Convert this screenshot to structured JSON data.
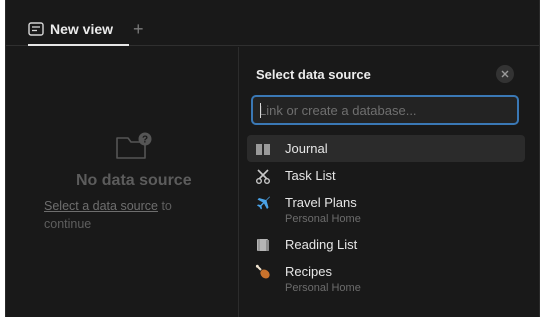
{
  "tab": {
    "label": "New view",
    "add_symbol": "+"
  },
  "empty_state": {
    "title": "No data source",
    "link_text": "Select a data source",
    "rest_text": " to continue"
  },
  "panel": {
    "title": "Select data source",
    "search_placeholder": "Link or create a database...",
    "search_value": "",
    "items": [
      {
        "label": "Journal",
        "sublabel": "",
        "icon": "book-icon",
        "active": true
      },
      {
        "label": "Task List",
        "sublabel": "",
        "icon": "scissors-icon",
        "active": false
      },
      {
        "label": "Travel Plans",
        "sublabel": "Personal Home",
        "icon": "airplane-icon",
        "active": false
      },
      {
        "label": "Reading List",
        "sublabel": "",
        "icon": "books-icon",
        "active": false
      },
      {
        "label": "Recipes",
        "sublabel": "Personal Home",
        "icon": "drumstick-icon",
        "active": false
      }
    ]
  },
  "colors": {
    "background": "#191919",
    "accent": "#3a78b5",
    "active_row": "#2b2b2b"
  }
}
